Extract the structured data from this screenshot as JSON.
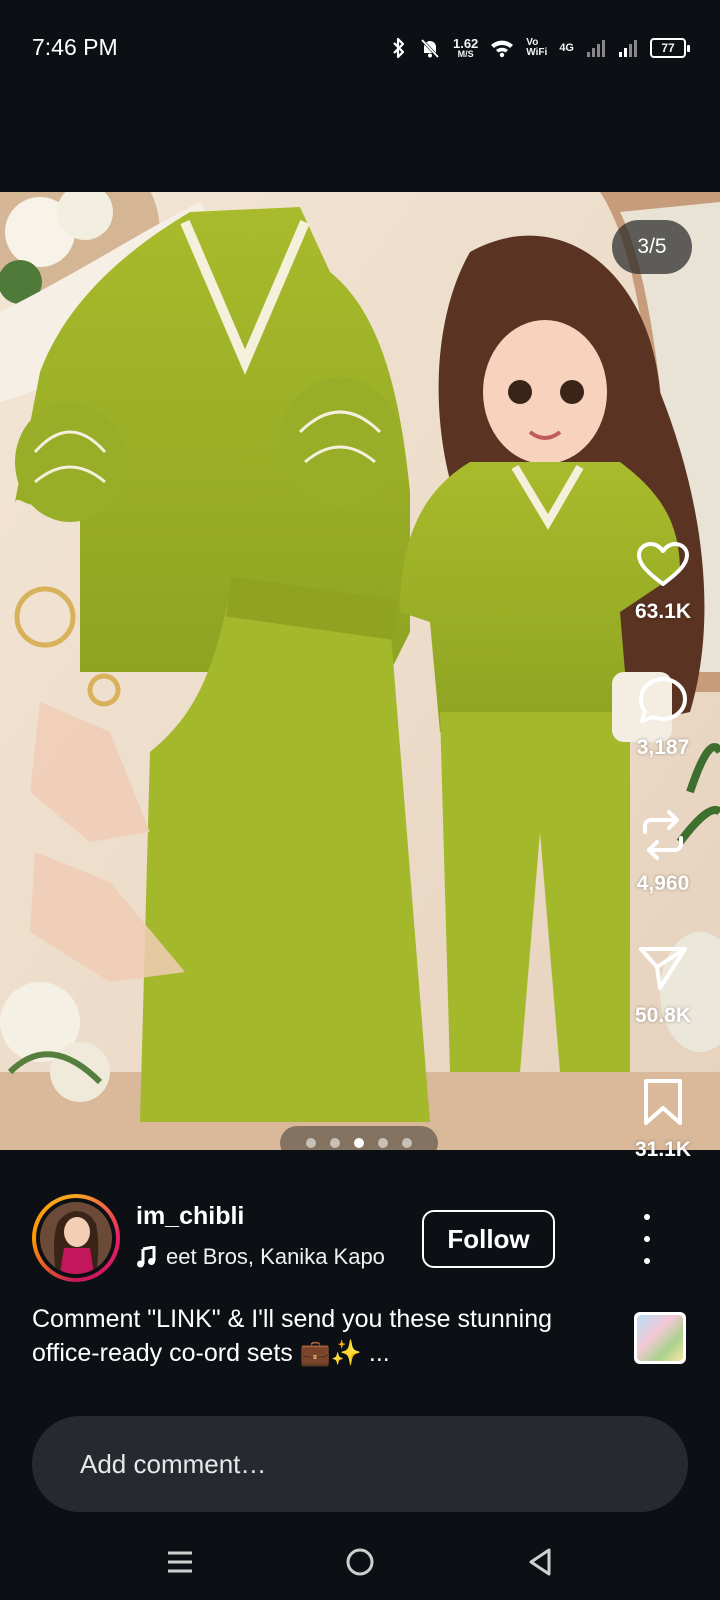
{
  "status_bar": {
    "time": "7:46 PM",
    "net_speed": "1.62",
    "net_unit": "M/S",
    "vo_line1": "Vo",
    "vo_line2": "WiFi",
    "network_type": "4G",
    "battery": "77"
  },
  "post": {
    "counter": "3/5",
    "slide_count": 5,
    "active_slide": 3,
    "likes": "63.1K",
    "comments": "3,187",
    "reposts": "4,960",
    "shares": "50.8K",
    "saves": "31.1K"
  },
  "author": {
    "username": "im_chibli",
    "music": "eet Bros, Kanika Kapo",
    "follow_label": "Follow"
  },
  "caption": {
    "text": "Comment \"LINK\" & I'll send you these stunning office-ready co-ord sets 💼✨ ..."
  },
  "comment_box": {
    "placeholder": "Add comment…"
  },
  "colors": {
    "background": "#0c1014",
    "outfit_green": "#9fb42a",
    "comment_bg": "#262a30"
  }
}
